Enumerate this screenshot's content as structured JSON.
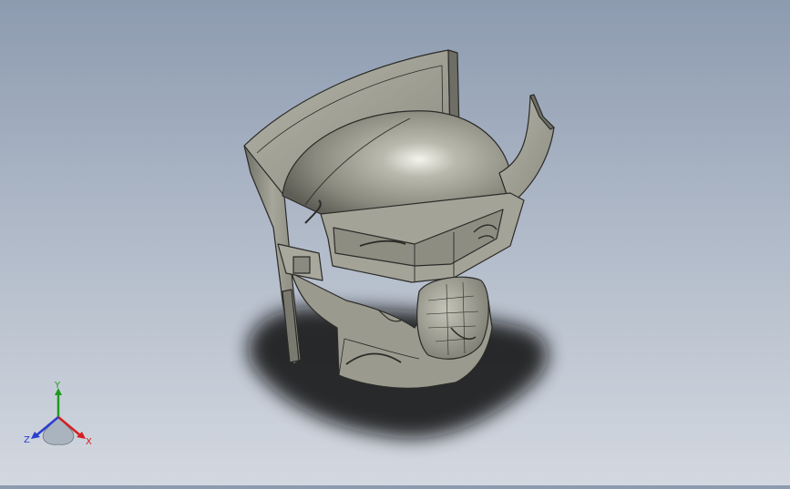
{
  "viewport": {
    "background_top": "#8d9bb0",
    "background_bottom": "#d3d8e0",
    "model_color": "#9a9a8f",
    "model_edge_color": "#2b2b28"
  },
  "triad": {
    "x_label": "X",
    "y_label": "Y",
    "z_label": "Z",
    "x_color": "#d42020",
    "y_color": "#1f9a1f",
    "z_color": "#2a3fd0"
  }
}
